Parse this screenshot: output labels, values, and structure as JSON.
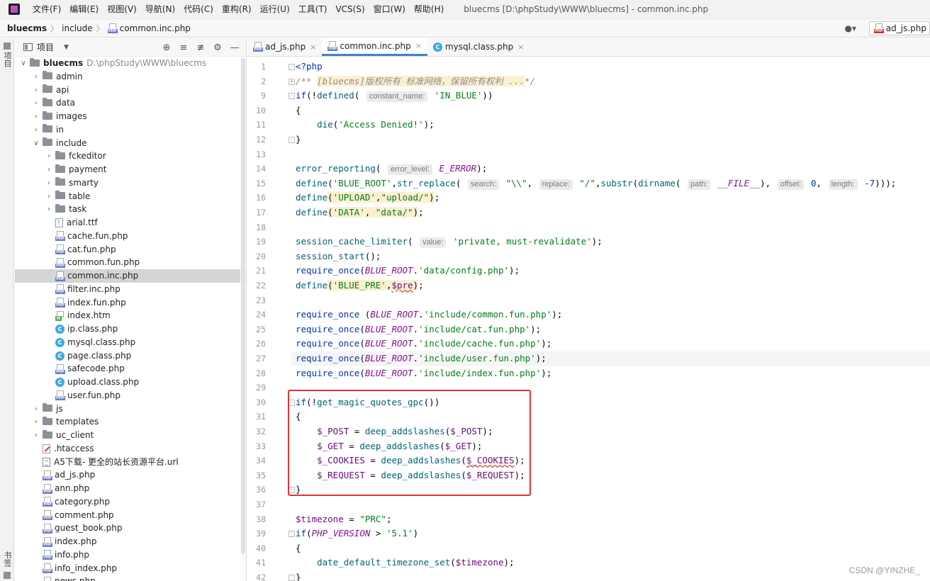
{
  "menubar": {
    "items": [
      "文件(F)",
      "编辑(E)",
      "视图(V)",
      "导航(N)",
      "代码(C)",
      "重构(R)",
      "运行(U)",
      "工具(T)",
      "VCS(S)",
      "窗口(W)",
      "帮助(H)"
    ],
    "window_title": "bluecms [D:\\phpStudy\\WWW\\bluecms] - common.inc.php"
  },
  "navbar": {
    "crumbs": [
      "bluecms",
      "include",
      "common.inc.php"
    ],
    "run_config": "ad_js.php"
  },
  "left_strip": {
    "project_label": "项目",
    "bookmarks_label": "书签"
  },
  "project_panel": {
    "title": "项目",
    "root": {
      "name": "bluecms",
      "path": "D:\\phpStudy\\WWW\\bluecms"
    },
    "tree": [
      {
        "name": "admin",
        "kind": "folder",
        "depth": 1,
        "expanded": false
      },
      {
        "name": "api",
        "kind": "folder",
        "depth": 1,
        "expanded": false
      },
      {
        "name": "data",
        "kind": "folder",
        "depth": 1,
        "expanded": false
      },
      {
        "name": "images",
        "kind": "folder",
        "depth": 1,
        "expanded": false
      },
      {
        "name": "in",
        "kind": "folder",
        "depth": 1,
        "expanded": false
      },
      {
        "name": "include",
        "kind": "folder",
        "depth": 1,
        "expanded": true
      },
      {
        "name": "fckeditor",
        "kind": "folder",
        "depth": 2,
        "expanded": false
      },
      {
        "name": "payment",
        "kind": "folder",
        "depth": 2,
        "expanded": false
      },
      {
        "name": "smarty",
        "kind": "folder",
        "depth": 2,
        "expanded": false
      },
      {
        "name": "table",
        "kind": "folder",
        "depth": 2,
        "expanded": false
      },
      {
        "name": "task",
        "kind": "folder",
        "depth": 2,
        "expanded": false
      },
      {
        "name": "arial.ttf",
        "kind": "font",
        "depth": 2
      },
      {
        "name": "cache.fun.php",
        "kind": "php",
        "depth": 2
      },
      {
        "name": "cat.fun.php",
        "kind": "php",
        "depth": 2
      },
      {
        "name": "common.fun.php",
        "kind": "php",
        "depth": 2
      },
      {
        "name": "common.inc.php",
        "kind": "php",
        "depth": 2,
        "selected": true
      },
      {
        "name": "filter.inc.php",
        "kind": "php",
        "depth": 2
      },
      {
        "name": "index.fun.php",
        "kind": "php",
        "depth": 2
      },
      {
        "name": "index.htm",
        "kind": "htm",
        "depth": 2
      },
      {
        "name": "ip.class.php",
        "kind": "class",
        "depth": 2
      },
      {
        "name": "mysql.class.php",
        "kind": "class",
        "depth": 2
      },
      {
        "name": "page.class.php",
        "kind": "class",
        "depth": 2
      },
      {
        "name": "safecode.php",
        "kind": "php",
        "depth": 2
      },
      {
        "name": "upload.class.php",
        "kind": "class",
        "depth": 2
      },
      {
        "name": "user.fun.php",
        "kind": "php",
        "depth": 2
      },
      {
        "name": "js",
        "kind": "folder",
        "depth": 1,
        "expanded": false
      },
      {
        "name": "templates",
        "kind": "folder",
        "depth": 1,
        "expanded": false
      },
      {
        "name": "uc_client",
        "kind": "folder",
        "depth": 1,
        "expanded": false
      },
      {
        "name": ".htaccess",
        "kind": "htaccess",
        "depth": 1
      },
      {
        "name": "A5下载- 更全的站长资源平台.url",
        "kind": "file",
        "depth": 1
      },
      {
        "name": "ad_js.php",
        "kind": "php",
        "depth": 1
      },
      {
        "name": "ann.php",
        "kind": "php",
        "depth": 1
      },
      {
        "name": "category.php",
        "kind": "php",
        "depth": 1
      },
      {
        "name": "comment.php",
        "kind": "php",
        "depth": 1
      },
      {
        "name": "guest_book.php",
        "kind": "php",
        "depth": 1
      },
      {
        "name": "index.php",
        "kind": "php",
        "depth": 1
      },
      {
        "name": "info.php",
        "kind": "php",
        "depth": 1
      },
      {
        "name": "info_index.php",
        "kind": "php",
        "depth": 1
      },
      {
        "name": "news.php",
        "kind": "php",
        "depth": 1
      }
    ]
  },
  "editor": {
    "tabs": [
      {
        "label": "ad_js.php",
        "icon": "php",
        "active": false
      },
      {
        "label": "common.inc.php",
        "icon": "php",
        "active": true
      },
      {
        "label": "mysql.class.php",
        "icon": "class",
        "active": false
      }
    ],
    "current_line": "27",
    "lines": [
      {
        "n": "1",
        "fold": "-",
        "html": "<span class=\"php-tag\">&lt;?php</span>"
      },
      {
        "n": "2",
        "fold": "+",
        "html": "<span class=\"cmt\">/** </span><span class=\"cmt hl\">[bluecms]版权所有 标准网络，保留所有权利 ...</span><span class=\"cmt\">*/</span>"
      },
      {
        "n": "9",
        "fold": "-",
        "html": "<span class=\"kw\">if</span>(!<span class=\"fn\">defined</span>( <span class=\"hint\">constant_name:</span> <span class=\"str\">'IN_BLUE'</span>))"
      },
      {
        "n": "10",
        "html": "{"
      },
      {
        "n": "11",
        "html": "    <span class=\"fn\">die</span>(<span class=\"str\">'Access Denied!'</span>);"
      },
      {
        "n": "12",
        "fold": "-",
        "html": "}"
      },
      {
        "n": "13",
        "html": ""
      },
      {
        "n": "14",
        "html": "<span class=\"fn\">error_reporting</span>( <span class=\"hint\">error_level:</span> <span class=\"cst\">E_ERROR</span>);"
      },
      {
        "n": "15",
        "html": "<span class=\"fn\">define</span>(<span class=\"str\">'BLUE_ROOT'</span>,<span class=\"fn\">str_replace</span>( <span class=\"hint\">search:</span> <span class=\"str\">\"\\\\\"</span>, <span class=\"hint\">replace:</span> <span class=\"str\">\"/\"</span>,<span class=\"fn\">substr</span>(<span class=\"fn\">dirname</span>( <span class=\"hint\">path:</span> <span class=\"cst\">__FILE__</span>), <span class=\"hint\">offset:</span> <span class=\"kw\">0</span>, <span class=\"hint\">length:</span> <span class=\"kw\">-7</span>)));"
      },
      {
        "n": "16",
        "html": "<span class=\"fn\">define</span><span class=\"hl\">(<span class=\"str\">'UPLOAD'</span>,<span class=\"str\">\"upload/\"</span>)</span>;"
      },
      {
        "n": "17",
        "html": "<span class=\"fn\">define</span><span class=\"hl\">(<span class=\"str\">'DATA'</span>, <span class=\"str\">\"data/\"</span>)</span>;"
      },
      {
        "n": "18",
        "html": ""
      },
      {
        "n": "19",
        "html": "<span class=\"fn\">session_cache_limiter</span>( <span class=\"hint\">value:</span> <span class=\"str\">'private, must-revalidate'</span>);"
      },
      {
        "n": "20",
        "html": "<span class=\"fn\">session_start</span>();"
      },
      {
        "n": "21",
        "html": "<span class=\"kw\">require_once</span>(<span class=\"cst\">BLUE_ROOT</span>.<span class=\"str\">'data/config.php'</span>);"
      },
      {
        "n": "22",
        "html": "<span class=\"fn\">define</span><span class=\"hl\">(<span class=\"str\">'BLUE_PRE'</span>,<span class=\"var squiggle\">$pre</span>)</span>;"
      },
      {
        "n": "23",
        "html": ""
      },
      {
        "n": "24",
        "html": "<span class=\"kw\">require_once</span> (<span class=\"cst\">BLUE_ROOT</span>.<span class=\"str\">'include/common.fun.php'</span>);"
      },
      {
        "n": "25",
        "html": "<span class=\"kw\">require_once</span>(<span class=\"cst\">BLUE_ROOT</span>.<span class=\"str\">'include/cat.fun.php'</span>);"
      },
      {
        "n": "26",
        "html": "<span class=\"kw\">require_once</span>(<span class=\"cst\">BLUE_ROOT</span>.<span class=\"str\">'include/cache.fun.php'</span>);"
      },
      {
        "n": "27",
        "html": "<span class=\"kw\">require_once</span>(<span class=\"cst\">BLUE_ROOT</span>.<span class=\"str\">'include/user.fun.php'</span>);"
      },
      {
        "n": "28",
        "html": "<span class=\"kw\">require_once</span>(<span class=\"cst\">BLUE_ROOT</span>.<span class=\"str\">'include/index.fun.php'</span>);"
      },
      {
        "n": "29",
        "html": ""
      },
      {
        "n": "30",
        "fold": "-",
        "html": "<span class=\"kw\">if</span>(!<span class=\"fn\">get_magic_quotes_gpc</span>())"
      },
      {
        "n": "31",
        "html": "{"
      },
      {
        "n": "32",
        "html": "    <span class=\"var\">$_POST</span> = <span class=\"fn\">deep_addslashes</span>(<span class=\"var\">$_POST</span>);"
      },
      {
        "n": "33",
        "html": "    <span class=\"var\">$_GET</span> = <span class=\"fn\">deep_addslashes</span>(<span class=\"var\">$_GET</span>);"
      },
      {
        "n": "34",
        "html": "    <span class=\"var\">$_COOKIES</span> = <span class=\"fn\">deep_addslashes</span>(<span class=\"var squiggle\">$_COOKIES</span>);"
      },
      {
        "n": "35",
        "html": "    <span class=\"var\">$_REQUEST</span> = <span class=\"fn\">deep_addslashes</span>(<span class=\"var\">$_REQUEST</span>);"
      },
      {
        "n": "36",
        "fold": "-",
        "html": "}"
      },
      {
        "n": "37",
        "html": ""
      },
      {
        "n": "38",
        "html": "<span class=\"var\">$timezone</span> = <span class=\"str\">\"PRC\"</span>;"
      },
      {
        "n": "39",
        "fold": "-",
        "html": "<span class=\"kw\">if</span>(<span class=\"cst\">PHP_VERSION</span> &gt; <span class=\"str\">'5.1'</span>)"
      },
      {
        "n": "40",
        "html": "{"
      },
      {
        "n": "41",
        "html": "    <span class=\"fn\">date_default_timezone_set</span>(<span class=\"var\">$timezone</span>);"
      },
      {
        "n": "42",
        "fold": "-",
        "html": "}"
      }
    ]
  },
  "watermark": "CSDN @YINZHE_",
  "colors": {
    "accent": "#4083c9",
    "highlight_box": "#e5322d",
    "keyword": "#0033b3",
    "string": "#067d17"
  }
}
